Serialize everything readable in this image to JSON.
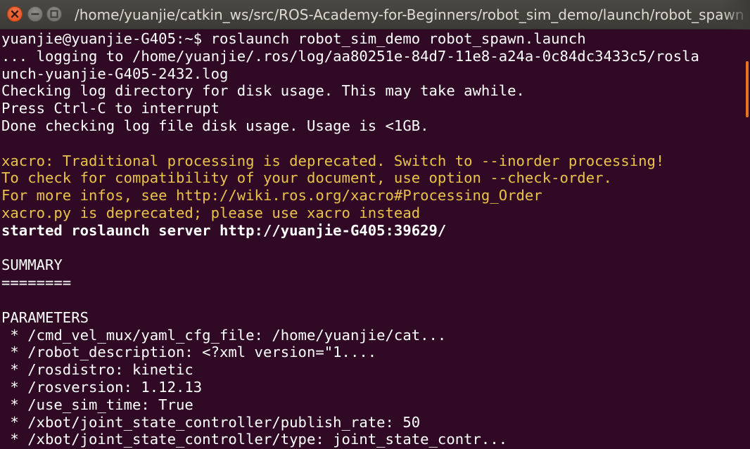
{
  "window": {
    "title": "/home/yuanjie/catkin_ws/src/ROS-Academy-for-Beginners/robot_sim_demo/launch/robot_spawn.launch"
  },
  "colors": {
    "background": "#300a24",
    "text": "#ffffff",
    "warning": "#eac24a",
    "scroll_thumb": "#e2761e"
  },
  "icons": {
    "close": "close-icon",
    "minimize": "minimize-icon",
    "maximize": "maximize-icon"
  },
  "terminal": {
    "lines": [
      {
        "text": "yuanjie@yuanjie-G405:~$ roslaunch robot_sim_demo robot_spawn.launch",
        "style": "normal"
      },
      {
        "text": "... logging to /home/yuanjie/.ros/log/aa80251e-84d7-11e8-a24a-0c84dc3433c5/rosla",
        "style": "normal"
      },
      {
        "text": "unch-yuanjie-G405-2432.log",
        "style": "normal"
      },
      {
        "text": "Checking log directory for disk usage. This may take awhile.",
        "style": "normal"
      },
      {
        "text": "Press Ctrl-C to interrupt",
        "style": "normal"
      },
      {
        "text": "Done checking log file disk usage. Usage is <1GB.",
        "style": "normal"
      },
      {
        "text": "",
        "style": "normal"
      },
      {
        "text": "xacro: Traditional processing is deprecated. Switch to --inorder processing!",
        "style": "warn"
      },
      {
        "text": "To check for compatibility of your document, use option --check-order.",
        "style": "warn"
      },
      {
        "text": "For more infos, see http://wiki.ros.org/xacro#Processing_Order",
        "style": "warn"
      },
      {
        "text": "xacro.py is deprecated; please use xacro instead",
        "style": "warn"
      },
      {
        "text": "started roslaunch server http://yuanjie-G405:39629/",
        "style": "bold"
      },
      {
        "text": "",
        "style": "normal"
      },
      {
        "text": "SUMMARY",
        "style": "normal"
      },
      {
        "text": "========",
        "style": "normal"
      },
      {
        "text": "",
        "style": "normal"
      },
      {
        "text": "PARAMETERS",
        "style": "normal"
      },
      {
        "text": " * /cmd_vel_mux/yaml_cfg_file: /home/yuanjie/cat...",
        "style": "normal"
      },
      {
        "text": " * /robot_description: <?xml version=\"1....",
        "style": "normal"
      },
      {
        "text": " * /rosdistro: kinetic",
        "style": "normal"
      },
      {
        "text": " * /rosversion: 1.12.13",
        "style": "normal"
      },
      {
        "text": " * /use_sim_time: True",
        "style": "normal"
      },
      {
        "text": " * /xbot/joint_state_controller/publish_rate: 50",
        "style": "normal"
      },
      {
        "text": " * /xbot/joint_state_controller/type: joint_state_contr...",
        "style": "normal"
      }
    ]
  }
}
